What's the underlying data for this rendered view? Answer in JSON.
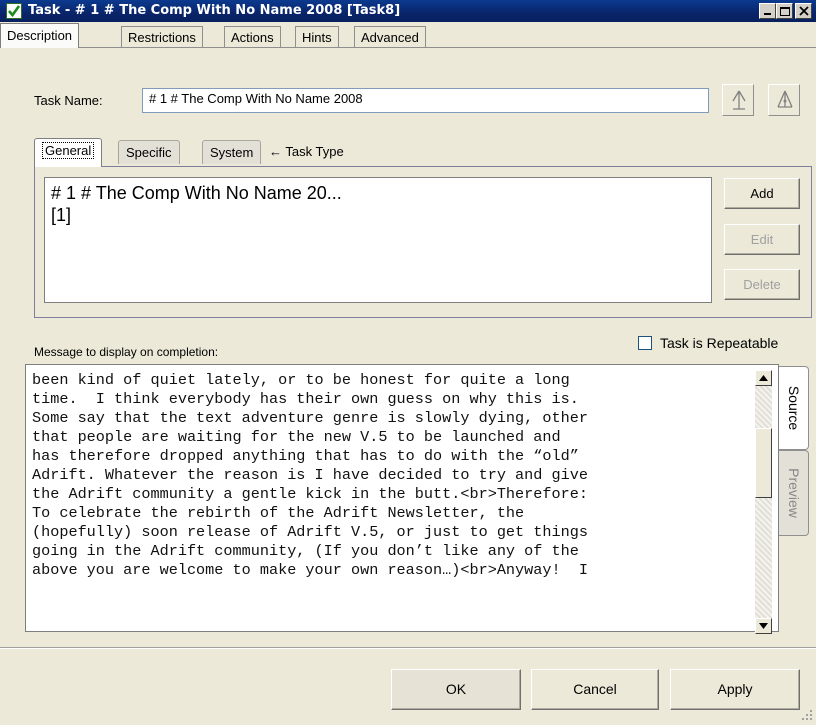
{
  "window": {
    "title": "Task - # 1 #  The Comp With No Name 2008  [Task8]",
    "icon": "checkmark-icon",
    "controls": [
      "minimize",
      "maximize",
      "close"
    ]
  },
  "main_tabs": [
    "Description",
    "Restrictions",
    "Actions",
    "Hints",
    "Advanced"
  ],
  "task_name": {
    "label": "Task Name:",
    "value": "# 1 #  The Comp With No Name 2008"
  },
  "icon_buttons": [
    "nav-up-icon",
    "nav-branch-icon"
  ],
  "sub_tabs": [
    "General",
    "Specific",
    "System"
  ],
  "task_type_label": "← Task Type",
  "command_list": {
    "items": [
      "# 1 #  The Comp With No Name 20...",
      "[1]"
    ]
  },
  "command_buttons": {
    "add": "Add",
    "edit": "Edit",
    "delete": "Delete"
  },
  "message_label": "Message to display on completion:",
  "repeatable": {
    "label": "Task is Repeatable",
    "checked": false
  },
  "message_source": "been kind of quiet lately, or to be honest for quite a long\ntime.  I think everybody has their own guess on why this is.\nSome say that the text adventure genre is slowly dying, other\nthat people are waiting for the new V.5 to be launched and\nhas therefore dropped anything that has to do with the “old”\nAdrift. Whatever the reason is I have decided to try and give\nthe Adrift community a gentle kick in the butt.<br>Therefore:\nTo celebrate the rebirth of the Adrift Newsletter, the\n(hopefully) soon release of Adrift V.5, or just to get things\ngoing in the Adrift community, (If you don’t like any of the\nabove you are welcome to make your own reason…)<br>Anyway!  I",
  "side_tabs": {
    "source": "Source",
    "preview": "Preview"
  },
  "footer_buttons": {
    "ok": "OK",
    "cancel": "Cancel",
    "apply": "Apply"
  },
  "colors": {
    "titlebar": "#0a246a",
    "dialog_bg": "#ece9d8",
    "focus_border": "#7f9db9"
  }
}
